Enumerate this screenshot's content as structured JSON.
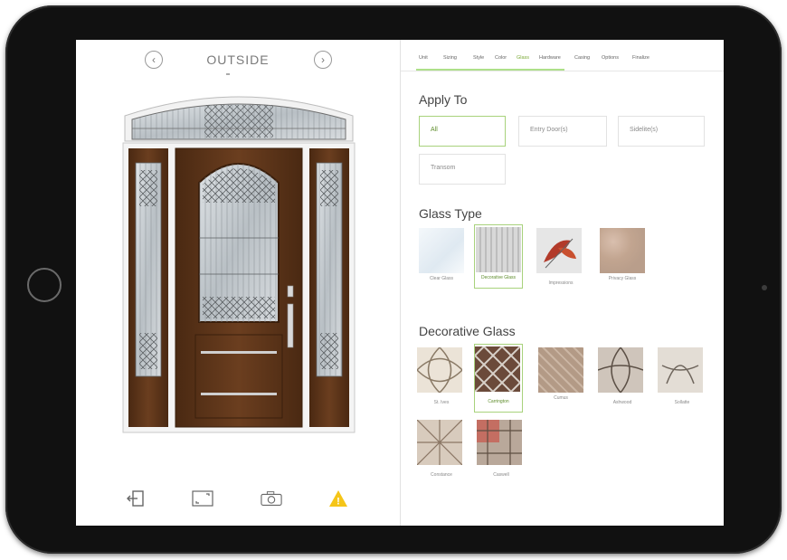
{
  "viewer": {
    "prev": "‹",
    "next": "›",
    "view_label": "OUTSIDE",
    "tools": [
      "exit-icon",
      "expand-icon",
      "camera-icon",
      "warning-icon"
    ],
    "warning_symbol": "!"
  },
  "tabs": [
    "Unit",
    "Sizing",
    "Style",
    "Color",
    "Glass",
    "Hardware",
    "Casing",
    "Options",
    "Finalize"
  ],
  "active_tab": "Glass",
  "apply_to": {
    "title": "Apply To",
    "options": [
      "All",
      "Entry Door(s)",
      "Sidelite(s)",
      "Transom"
    ],
    "selected": "All"
  },
  "glass_type": {
    "title": "Glass Type",
    "items": [
      {
        "label": "Clear Glass"
      },
      {
        "label": "Decorative Glass"
      },
      {
        "label": "Impressions"
      },
      {
        "label": "Privacy Glass"
      }
    ],
    "selected": "Decorative Glass"
  },
  "decorative_glass": {
    "title": "Decorative Glass",
    "items": [
      {
        "label": "St. Ives"
      },
      {
        "label": "Carrington"
      },
      {
        "label": "Cumus"
      },
      {
        "label": "Ashwood"
      },
      {
        "label": "Sollatte"
      },
      {
        "label": "Constance"
      },
      {
        "label": "Caswell"
      }
    ],
    "selected": "Carrington"
  },
  "colors": {
    "accent": "#7dab3a",
    "selected_border": "#a8d27c",
    "door_wood": "#5a3318",
    "frame_white": "#f4f4f4",
    "warning": "#f5c518"
  }
}
